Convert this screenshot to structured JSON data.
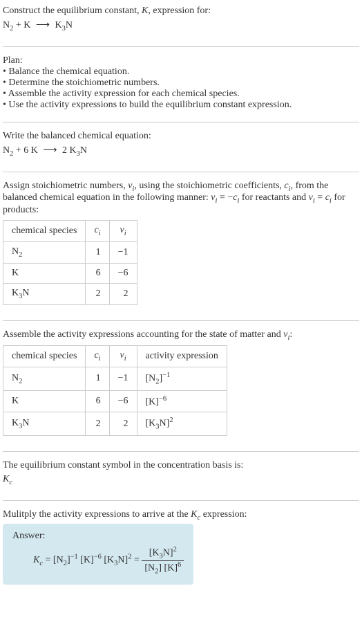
{
  "intro": {
    "line1": "Construct the equilibrium constant, ",
    "K": "K",
    "line1b": ", expression for:",
    "eq_lhs": "N",
    "eq_sub1": "2",
    "eq_plus": " + K ",
    "eq_arrow": "⟶",
    "eq_rhs": " K",
    "eq_sub2": "3",
    "eq_rhs2": "N"
  },
  "plan": {
    "title": "Plan:",
    "b1": "• Balance the chemical equation.",
    "b2": "• Determine the stoichiometric numbers.",
    "b3": "• Assemble the activity expression for each chemical species.",
    "b4": "• Use the activity expressions to build the equilibrium constant expression."
  },
  "balanced": {
    "title": "Write the balanced chemical equation:",
    "lhs1": "N",
    "sub1": "2",
    "plus": " + 6 K ",
    "arrow": "⟶",
    "rhs": " 2 K",
    "sub2": "3",
    "rhs2": "N"
  },
  "assign": {
    "text1": "Assign stoichiometric numbers, ",
    "nu_i": "ν",
    "nu_sub": "i",
    "text2": ", using the stoichiometric coefficients, ",
    "c_i": "c",
    "c_sub": "i",
    "text3": ", from the balanced chemical equation in the following manner: ",
    "eq1a": "ν",
    "eq1b": "i",
    "eq1c": " = −",
    "eq1d": "c",
    "eq1e": "i",
    "text4": " for reactants and ",
    "eq2a": "ν",
    "eq2b": "i",
    "eq2c": " = ",
    "eq2d": "c",
    "eq2e": "i",
    "text5": " for products:"
  },
  "table1": {
    "h1": "chemical species",
    "h2_a": "c",
    "h2_b": "i",
    "h3_a": "ν",
    "h3_b": "i",
    "r1c1a": "N",
    "r1c1b": "2",
    "r1c2": "1",
    "r1c3": "−1",
    "r2c1": "K",
    "r2c2": "6",
    "r2c3": "−6",
    "r3c1a": "K",
    "r3c1b": "3",
    "r3c1c": "N",
    "r3c2": "2",
    "r3c3": "2"
  },
  "assemble": {
    "text1": "Assemble the activity expressions accounting for the state of matter and ",
    "nu": "ν",
    "nu_sub": "i",
    "text2": ":"
  },
  "table2": {
    "h1": "chemical species",
    "h2_a": "c",
    "h2_b": "i",
    "h3_a": "ν",
    "h3_b": "i",
    "h4": "activity expression",
    "r1c1a": "N",
    "r1c1b": "2",
    "r1c2": "1",
    "r1c3": "−1",
    "r1c4a": "[N",
    "r1c4b": "2",
    "r1c4c": "]",
    "r1c4d": "−1",
    "r2c1": "K",
    "r2c2": "6",
    "r2c3": "−6",
    "r2c4a": "[K]",
    "r2c4b": "−6",
    "r3c1a": "K",
    "r3c1b": "3",
    "r3c1c": "N",
    "r3c2": "2",
    "r3c3": "2",
    "r3c4a": "[K",
    "r3c4b": "3",
    "r3c4c": "N]",
    "r3c4d": "2"
  },
  "symbol": {
    "text1": "The equilibrium constant symbol in the concentration basis is:",
    "K": "K",
    "c": "c"
  },
  "multiply": {
    "text1": "Mulitply the activity expressions to arrive at the ",
    "K": "K",
    "c": "c",
    "text2": " expression:"
  },
  "answer": {
    "label": "Answer:",
    "K": "K",
    "c": "c",
    "eq": " = [N",
    "sub1": "2",
    "part2": "]",
    "exp1": "−1",
    "part3": " [K]",
    "exp2": "−6",
    "part4": " [K",
    "sub2": "3",
    "part5": "N]",
    "exp3": "2",
    "eq2": " = ",
    "num1": "[K",
    "num_sub": "3",
    "num2": "N]",
    "num_exp": "2",
    "den1": "[N",
    "den_sub": "2",
    "den2": "] [K]",
    "den_exp": "6"
  }
}
